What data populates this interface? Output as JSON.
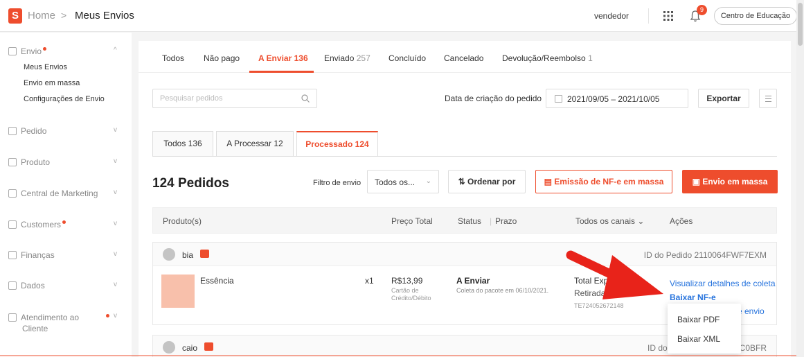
{
  "header": {
    "logo_letter": "S",
    "breadcrumb_home": "Home",
    "breadcrumb_sep": ">",
    "breadcrumb_current": "Meus Envios",
    "user": "vendedor",
    "notification_count": "9",
    "education_label": "Centro de Educação"
  },
  "sidebar": {
    "sections": [
      {
        "label": "Envio",
        "dot": true,
        "chevron": "^"
      },
      {
        "label": "Pedido",
        "chevron": "v"
      },
      {
        "label": "Produto",
        "chevron": "v"
      },
      {
        "label": "Central de Marketing",
        "chevron": "v"
      },
      {
        "label": "Customers",
        "dot": true,
        "chevron": "v"
      },
      {
        "label": "Finanças",
        "chevron": "v"
      },
      {
        "label": "Dados",
        "chevron": "v"
      },
      {
        "label": "Atendimento ao",
        "label2": "Cliente",
        "dot": true,
        "chevron": "v"
      }
    ],
    "envio_items": [
      "Meus Envios",
      "Envio em massa",
      "Configurações de Envio"
    ]
  },
  "tabs": [
    {
      "label": "Todos",
      "count": ""
    },
    {
      "label": "Não pago",
      "count": ""
    },
    {
      "label": "A Enviar",
      "count": "136"
    },
    {
      "label": "Enviado",
      "count": "257"
    },
    {
      "label": "Concluído",
      "count": ""
    },
    {
      "label": "Cancelado",
      "count": ""
    },
    {
      "label": "Devolução/Reembolso",
      "count": "1"
    }
  ],
  "search": {
    "placeholder": "Pesquisar pedidos"
  },
  "date_filter": {
    "label": "Data de criação do pedido",
    "range": "2021/09/05 – 2021/10/05"
  },
  "export_label": "Exportar",
  "subtabs": [
    {
      "label": "Todos",
      "count": "136"
    },
    {
      "label": "A Processar",
      "count": "12"
    },
    {
      "label": "Processado",
      "count": "124"
    }
  ],
  "orders_count_title": "124 Pedidos",
  "ship_filter": {
    "label": "Filtro de envio",
    "value": "Todos os..."
  },
  "sort_label": "Ordenar por",
  "nfe_mass_label": "Emissão de NF-e em massa",
  "mass_ship_label": "Envio em massa",
  "table_headers": {
    "product": "Produto(s)",
    "total_price": "Preço Total",
    "status": "Status",
    "deadline": "Prazo",
    "channels": "Todos os canais",
    "actions": "Ações"
  },
  "orders": [
    {
      "buyer": "bia",
      "order_id": "ID do Pedido 2110064FWF7EXM",
      "product": "Essência",
      "qty": "x1",
      "price": "R$13,99",
      "payment": "Cartão de Crédito/Débito",
      "status": "A Enviar",
      "pickup": "Coleta do pacote em 06/10/2021.",
      "carrier": "Total Expre",
      "method": "Retirada",
      "tracking": "TE724052672148",
      "action_view": "Visualizar detalhes de coleta",
      "action_nfe": "Baixar NF-e",
      "action_partial": "e envio"
    },
    {
      "buyer": "caio",
      "order_id_prefix": "ID do",
      "order_id_suffix": "PC0BFR"
    }
  ],
  "nfe_dropdown": {
    "pdf": "Baixar PDF",
    "xml": "Baixar XML"
  },
  "colors": {
    "brand": "#ee4d2d",
    "link": "#2673dd",
    "arrow": "#e8231a"
  }
}
